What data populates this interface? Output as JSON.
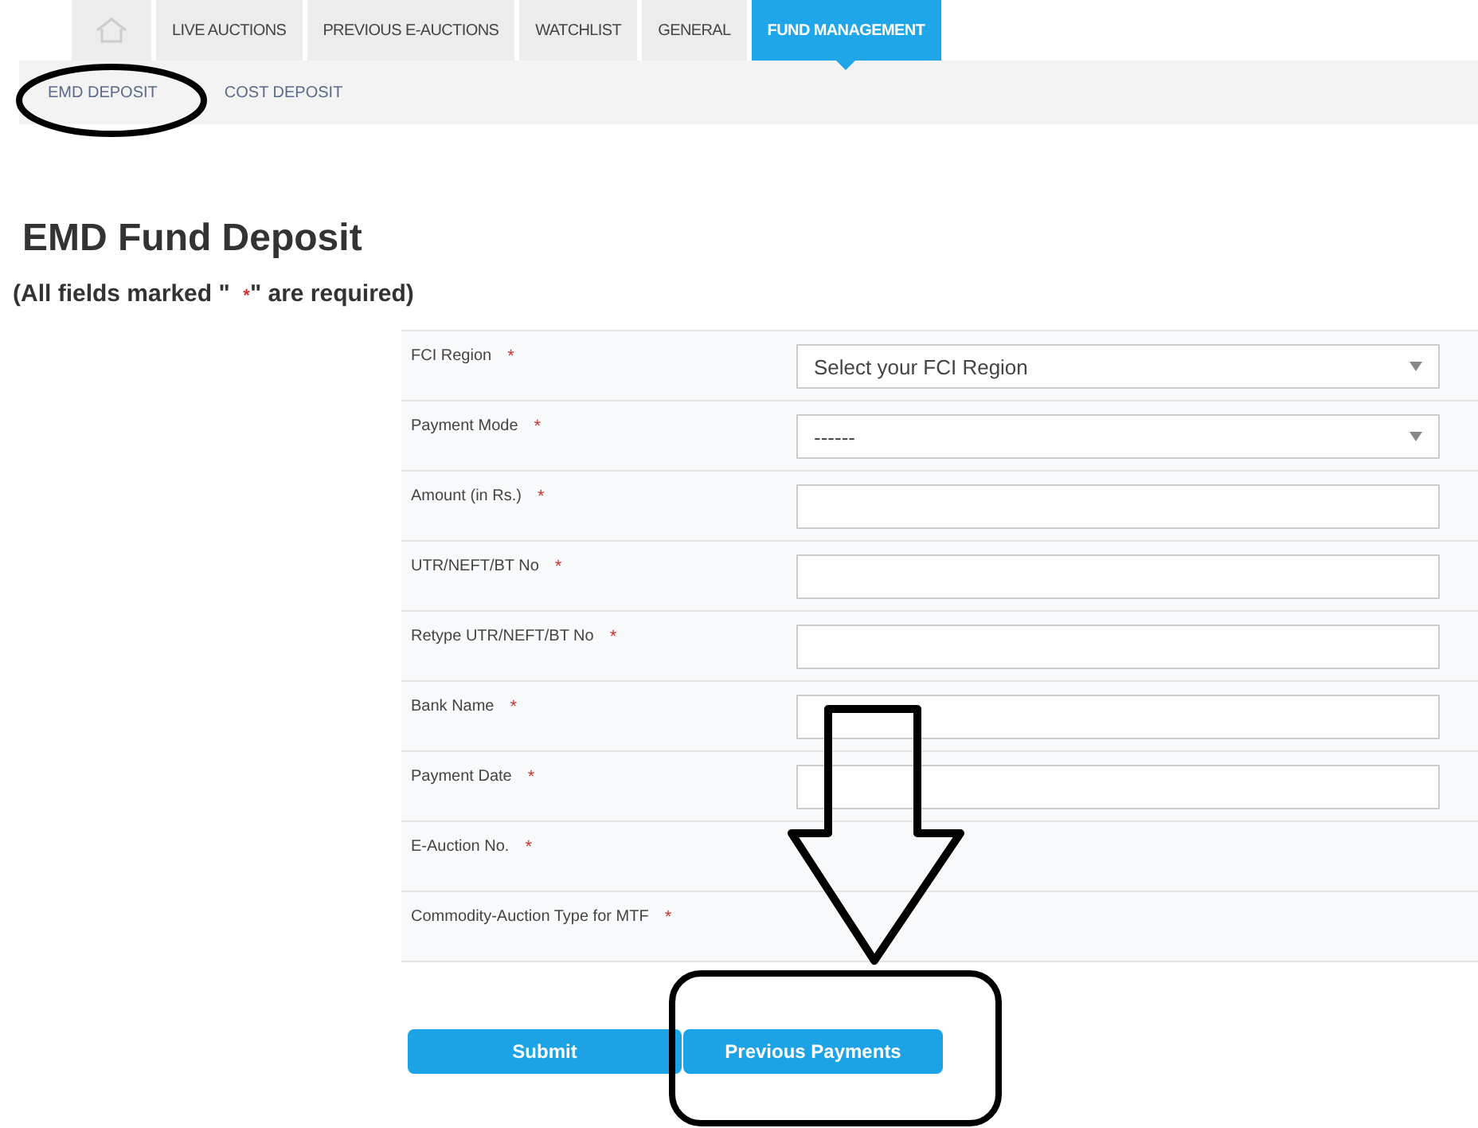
{
  "tabs": [
    {
      "label": "LIVE AUCTIONS",
      "selected": false
    },
    {
      "label": "PREVIOUS E-AUCTIONS",
      "selected": false
    },
    {
      "label": "WATCHLIST",
      "selected": false
    },
    {
      "label": "GENERAL",
      "selected": false
    },
    {
      "label": "FUND MANAGEMENT",
      "selected": true
    }
  ],
  "subnav": [
    "EMD DEPOSIT",
    "COST DEPOSIT"
  ],
  "title": "EMD Fund Deposit",
  "note": {
    "before": "(All fields marked \"",
    "mark": "*",
    "after": "\" are required)"
  },
  "fields": [
    {
      "label": "FCI Region",
      "required": "*",
      "kind": "select",
      "value": "Select your FCI Region"
    },
    {
      "label": "Payment Mode",
      "required": "*",
      "kind": "select",
      "value": "------"
    },
    {
      "label": "Amount (in Rs.)",
      "required": "*",
      "kind": "input"
    },
    {
      "label": "UTR/NEFT/BT No",
      "required": "*",
      "kind": "input"
    },
    {
      "label": "Retype UTR/NEFT/BT No",
      "required": "*",
      "kind": "input"
    },
    {
      "label": "Bank Name",
      "required": "*",
      "kind": "input"
    },
    {
      "label": "Payment Date",
      "required": "*",
      "kind": "input"
    },
    {
      "label": "E-Auction No.",
      "required": "*",
      "kind": "none"
    },
    {
      "label": "Commodity-Auction Type for MTF",
      "required": "*",
      "kind": "none"
    }
  ],
  "buttons": [
    "Submit",
    "Previous Payments"
  ]
}
